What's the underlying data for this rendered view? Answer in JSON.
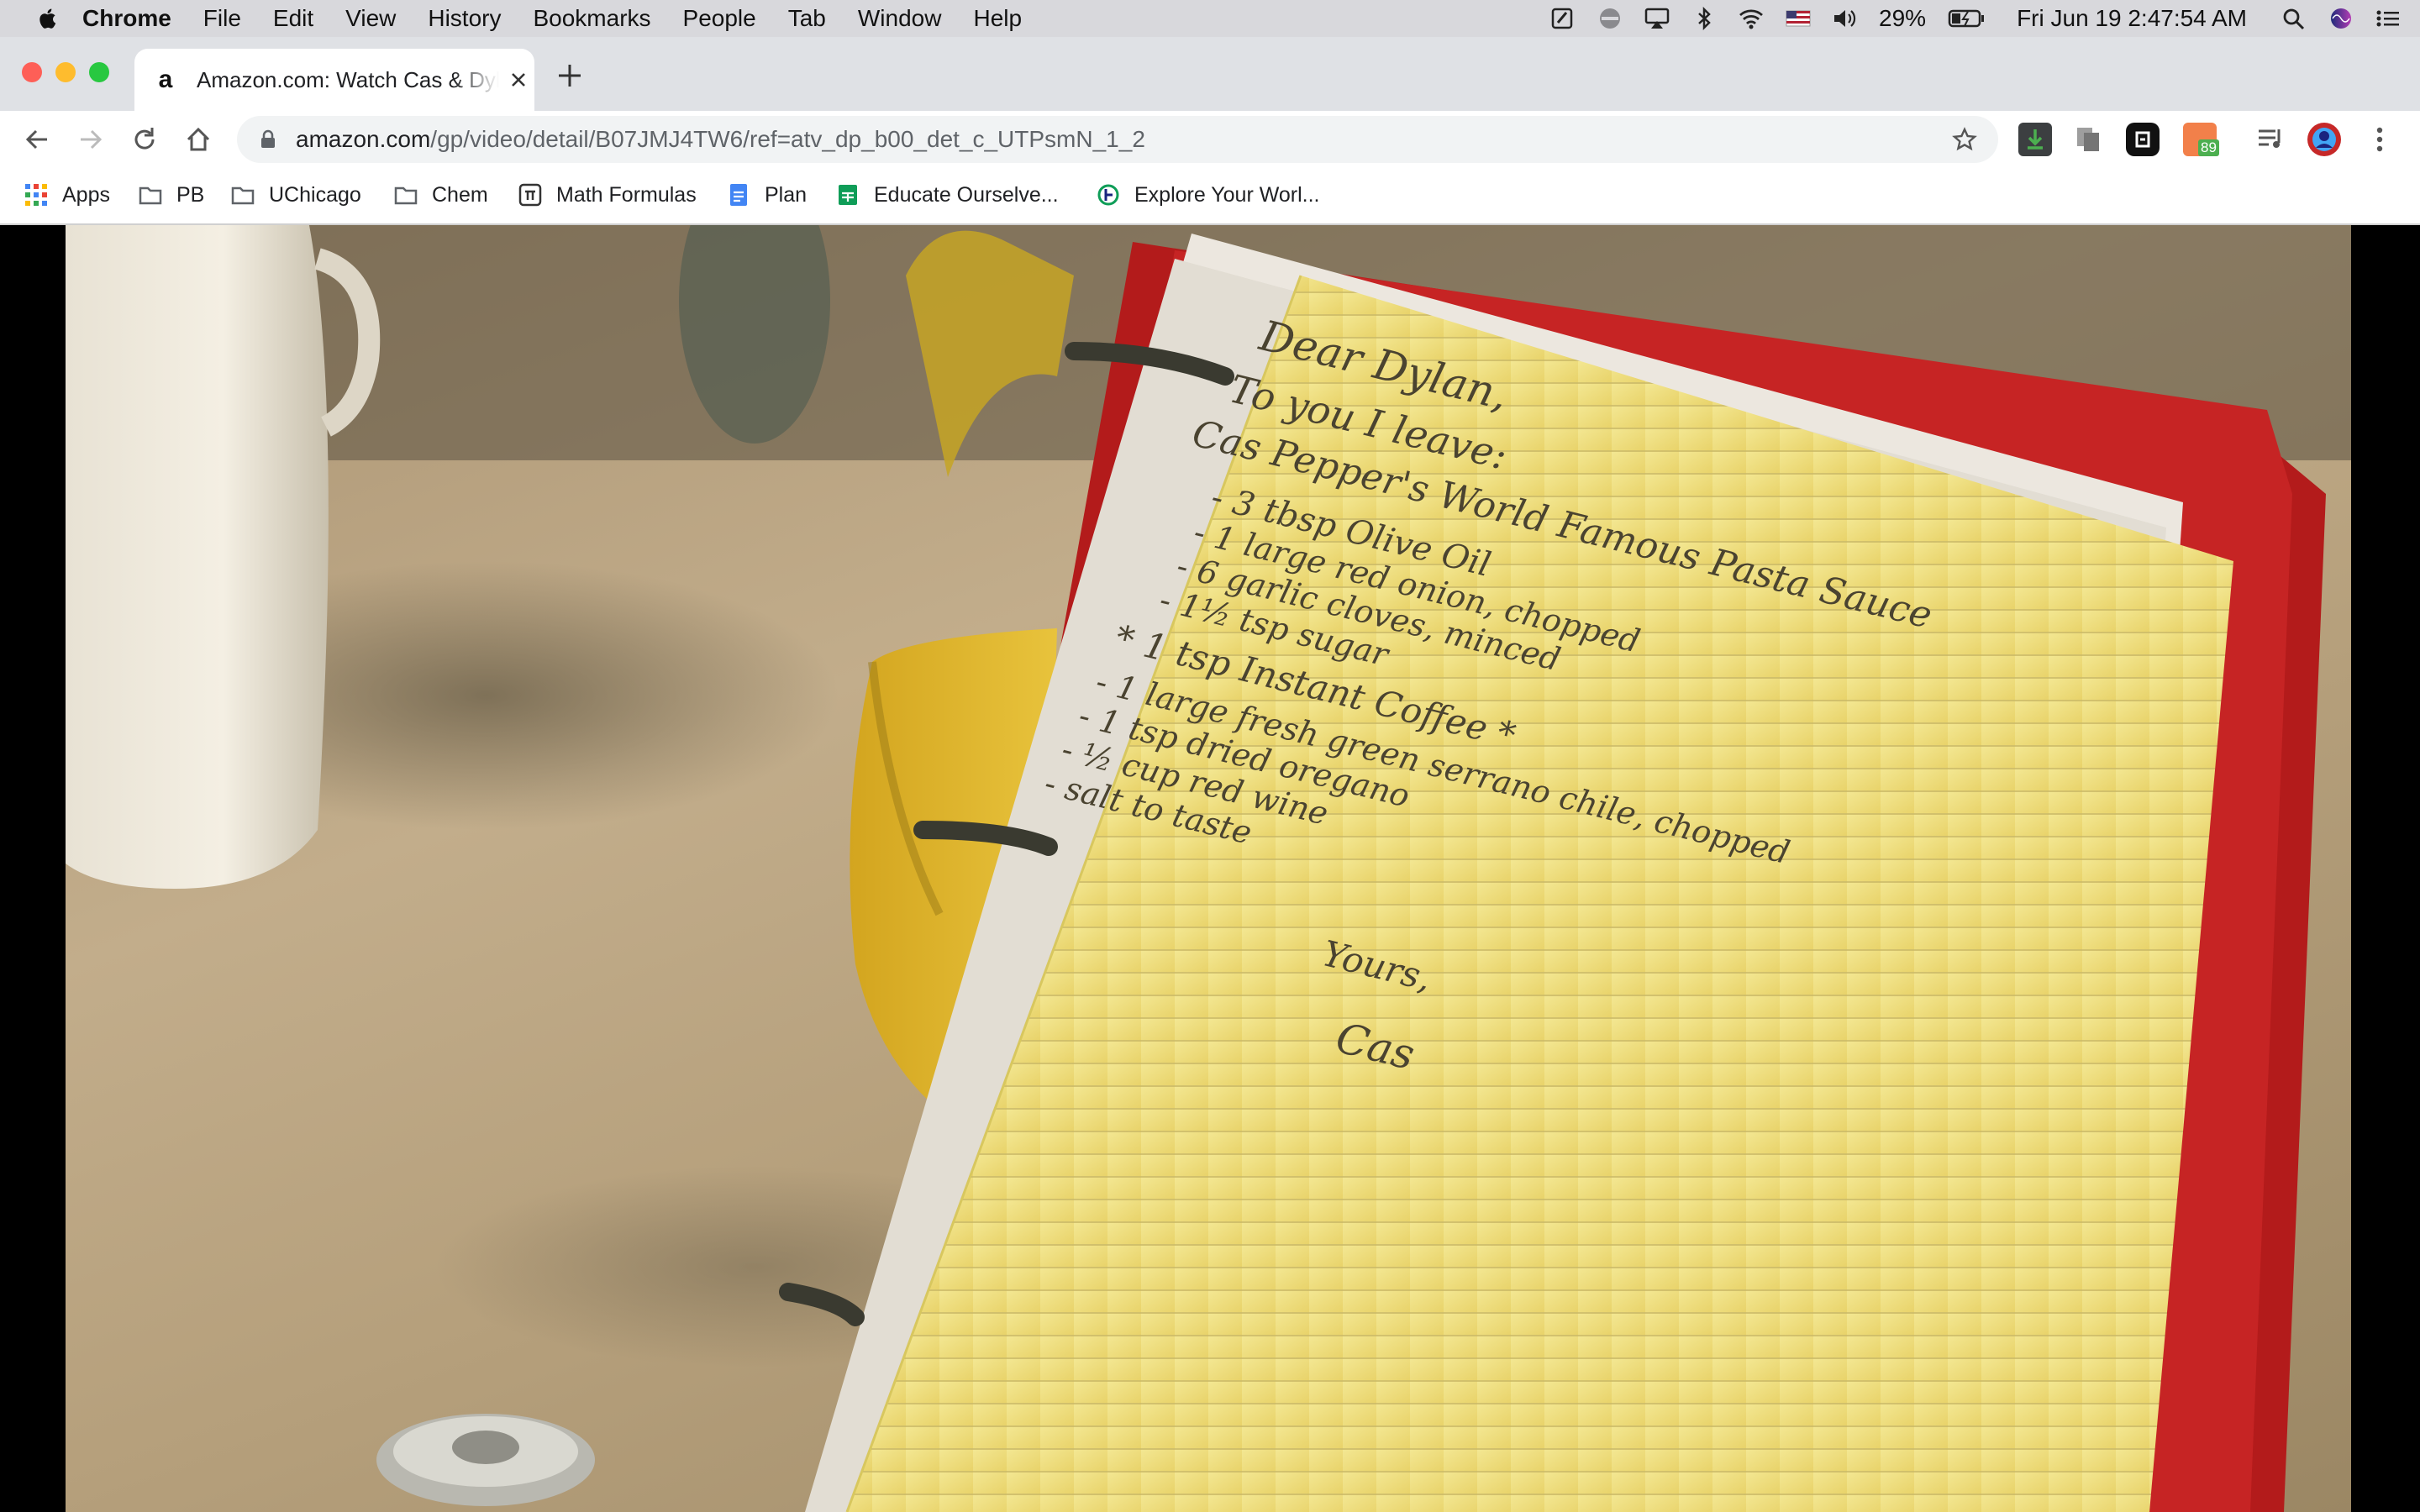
{
  "menubar": {
    "app": "Chrome",
    "items": [
      "File",
      "Edit",
      "View",
      "History",
      "Bookmarks",
      "People",
      "Tab",
      "Window",
      "Help"
    ],
    "battery": "29%",
    "clock": "Fri Jun 19  2:47:54 AM"
  },
  "tab": {
    "title": "Amazon.com: Watch Cas & Dylan",
    "favicon": "a"
  },
  "omnibox": {
    "domain": "amazon.com",
    "path": "/gp/video/detail/B07JMJ4TW6/ref=atv_dp_b00_det_c_UTPsmN_1_2"
  },
  "extensions": {
    "badge": "89"
  },
  "bookmarks": [
    "Apps",
    "PB",
    "UChicago",
    "Chem",
    "Math Formulas",
    "Plan",
    "Educate Ourselve...",
    "Explore Your Worl..."
  ],
  "note": {
    "greeting": "Dear Dylan,",
    "intro": "To you I leave:",
    "recipe_title": "Cas Pepper's World Famous Pasta Sauce",
    "ingredients": [
      "- 3 tbsp Olive Oil",
      "- 1 large red onion, chopped",
      "- 6 garlic cloves, minced",
      "- 1½ tsp sugar",
      "* 1 tsp Instant Coffee *",
      "- 1 large fresh green serrano chile, chopped",
      "- 1 tsp dried oregano",
      "- ½ cup red wine",
      "- salt to taste"
    ],
    "closing": "Yours,",
    "signature": "Cas"
  }
}
